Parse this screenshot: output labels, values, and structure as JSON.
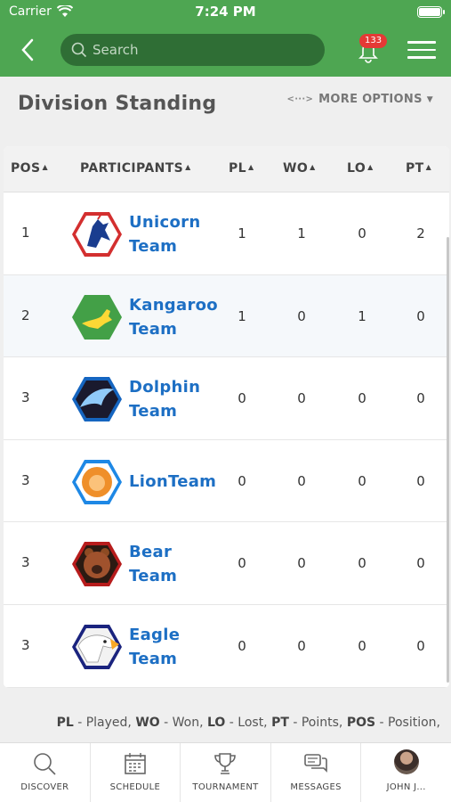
{
  "status_bar": {
    "carrier": "Carrier",
    "time": "7:24 PM"
  },
  "header": {
    "search_placeholder": "Search",
    "notification_count": "133",
    "accent_color": "#4ea652"
  },
  "page": {
    "title": "Division Standing",
    "more_options_label": "MORE OPTIONS"
  },
  "table": {
    "columns": [
      "POS",
      "PARTICIPANTS",
      "PL",
      "WO",
      "LO",
      "PT"
    ],
    "rows": [
      {
        "pos": "1",
        "team_line1": "Unicorn",
        "team_line2": "Team",
        "pl": "1",
        "wo": "1",
        "lo": "0",
        "pt": "2",
        "logo": "unicorn-logo"
      },
      {
        "pos": "2",
        "team_line1": "Kangaroo",
        "team_line2": "Team",
        "pl": "1",
        "wo": "0",
        "lo": "1",
        "pt": "0",
        "logo": "kangaroo-logo"
      },
      {
        "pos": "3",
        "team_line1": "Dolphin",
        "team_line2": "Team",
        "pl": "0",
        "wo": "0",
        "lo": "0",
        "pt": "0",
        "logo": "dolphin-logo"
      },
      {
        "pos": "3",
        "team_line1": "LionTeam",
        "team_line2": "",
        "pl": "0",
        "wo": "0",
        "lo": "0",
        "pt": "0",
        "logo": "lion-logo"
      },
      {
        "pos": "3",
        "team_line1": "Bear",
        "team_line2": "Team",
        "pl": "0",
        "wo": "0",
        "lo": "0",
        "pt": "0",
        "logo": "bear-logo"
      },
      {
        "pos": "3",
        "team_line1": "Eagle",
        "team_line2": "Team",
        "pl": "0",
        "wo": "0",
        "lo": "0",
        "pt": "0",
        "logo": "eagle-logo"
      }
    ]
  },
  "legend": {
    "pl_key": "PL",
    "pl_text": " - Played, ",
    "wo_key": "WO",
    "wo_text": " - Won, ",
    "lo_key": "LO",
    "lo_text": " - Lost, ",
    "pt_key": "PT",
    "pt_text": " - Points, ",
    "pos_key": "POS",
    "pos_text": " - Position,"
  },
  "tabbar": {
    "tabs": [
      {
        "label": "DISCOVER",
        "icon": "search-icon"
      },
      {
        "label": "SCHEDULE",
        "icon": "calendar-icon"
      },
      {
        "label": "TOURNAMENT",
        "icon": "trophy-icon"
      },
      {
        "label": "MESSAGES",
        "icon": "chat-icon"
      },
      {
        "label": "JOHN J...",
        "icon": "avatar"
      }
    ]
  }
}
